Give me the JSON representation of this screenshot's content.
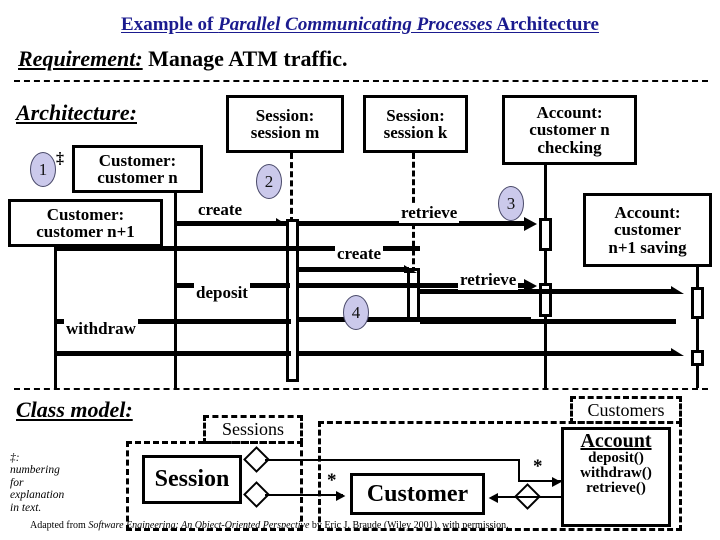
{
  "title": {
    "part1": "Example of ",
    "part2": "Parallel Communicating Processes",
    "part3": " Architecture",
    "color": "#1b1b8f"
  },
  "requirement": {
    "label": "Requirement:",
    "text": " Manage ATM traffic."
  },
  "sections": {
    "architecture": "Architecture:",
    "class_model": "Class model:"
  },
  "sequence": {
    "objects": [
      {
        "id": "customer-n",
        "line1": "Customer:",
        "line2": "customer n"
      },
      {
        "id": "customer-n1",
        "line1": "Customer:",
        "line2": "customer n+1"
      },
      {
        "id": "session-m",
        "line1": "Session:",
        "line2": "session m"
      },
      {
        "id": "session-k",
        "line1": "Session:",
        "line2": "session k"
      },
      {
        "id": "account-checking",
        "line1": "Account:",
        "line2": "customer n",
        "line3": "checking"
      },
      {
        "id": "account-saving",
        "line1": "Account:",
        "line2": "customer",
        "line3": "n+1 saving"
      }
    ],
    "messages": [
      {
        "id": "create-session-m",
        "label": "create"
      },
      {
        "id": "retrieve-account",
        "label": "retrieve"
      },
      {
        "id": "create-session-k",
        "label": "create"
      },
      {
        "id": "deposit",
        "label": "deposit"
      },
      {
        "id": "retrieve-saving",
        "label": "retrieve"
      },
      {
        "id": "withdraw",
        "label": "withdraw"
      }
    ],
    "step_numbers": [
      "1",
      "2",
      "3",
      "4"
    ],
    "dagger": "‡"
  },
  "class_model": {
    "packages": [
      {
        "id": "sessions",
        "label": "Sessions"
      },
      {
        "id": "customers",
        "label": "Customers"
      }
    ],
    "classes": [
      {
        "id": "session",
        "name": "Session",
        "operations": []
      },
      {
        "id": "customer",
        "name": "Customer",
        "operations": []
      },
      {
        "id": "account",
        "name": "Account",
        "operations": [
          "deposit()",
          "withdraw()",
          "retrieve()"
        ]
      }
    ],
    "multiplicities": [
      "*",
      "*"
    ]
  },
  "note": {
    "symbol": "‡:",
    "lines": [
      "numbering",
      "for",
      "explanation",
      "in text."
    ]
  },
  "credit": {
    "prefix": "Adapted from ",
    "book": "Software Engineering: An Object-Oriented Perspective",
    "suffix": " by Eric J. Braude (Wiley 2001), with permission."
  },
  "colors": {
    "title": "#1b1b8f",
    "step_circle_fill": "#cbc9eb",
    "ink": "#000000"
  }
}
